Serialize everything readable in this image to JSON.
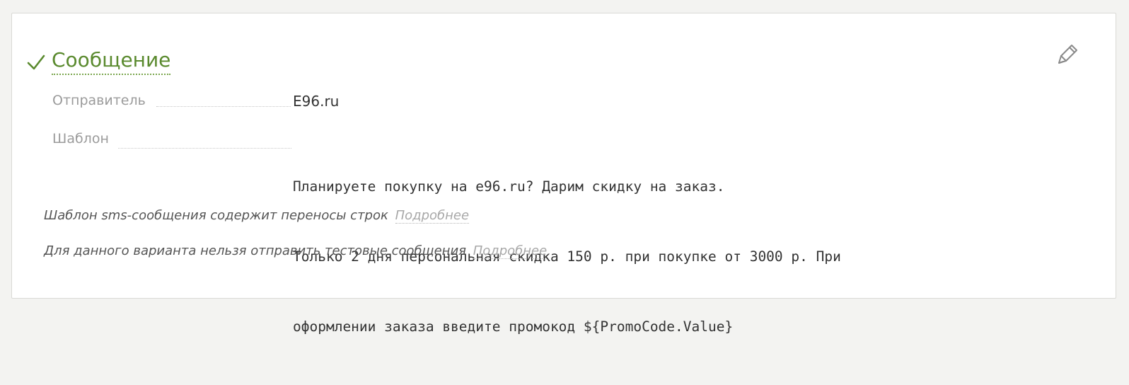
{
  "section": {
    "title": "Сообщение",
    "status_icon": "check-icon",
    "edit_icon": "pen-icon",
    "accent_color": "#5a8a2e"
  },
  "fields": {
    "sender": {
      "label": "Отправитель",
      "value": "E96.ru"
    },
    "template": {
      "label": "Шаблон",
      "lines": [
        "Планируете покупку на e96.ru? Дарим скидку на заказ.",
        "Только 2 дня персональная скидка 150 р. при покупке от 3000 р. При",
        "оформлении заказа введите промокод ${PromoCode.Value}"
      ]
    }
  },
  "notes": [
    {
      "text": "Шаблон sms-сообщения содержит переносы строк",
      "link": "Подробнее"
    },
    {
      "text": "Для данного варианта нельзя отправить тестовые сообщения",
      "link": "Подробнее"
    }
  ]
}
